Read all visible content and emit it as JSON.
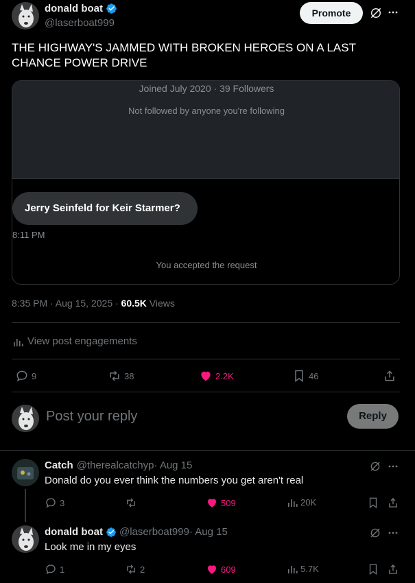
{
  "post": {
    "author_name": "donald boat",
    "author_handle": "@laserboat999",
    "promote_label": "Promote",
    "text": "THE HIGHWAY'S JAMMED WITH BROKEN HEROES ON A LAST CHANCE POWER DRIVE",
    "timestamp": "8:35 PM · Aug 15, 2025 · ",
    "views_count": "60.5K",
    "views_label": "Views",
    "engagements_label": "View post engagements"
  },
  "embedded_card": {
    "joined": "Joined July 2020 · 39 Followers",
    "not_followed": "Not followed by anyone you're following",
    "message": "Jerry Seinfeld for Keir Starmer?",
    "message_time": "8:11 PM",
    "accepted": "You accepted the request"
  },
  "actions": {
    "replies": "9",
    "reposts": "38",
    "likes": "2.2K",
    "bookmarks": "46"
  },
  "composer": {
    "placeholder": "Post your reply",
    "reply_label": "Reply"
  },
  "replies": [
    {
      "author_name": "Catch",
      "author_handle": "@therealcatchyp",
      "date": " · Aug 15",
      "text": "Donald do you ever think the numbers you get aren't real",
      "replies": "3",
      "reposts": "",
      "likes": "509",
      "views": "20K"
    },
    {
      "author_name": "donald boat",
      "author_handle": "@laserboat999",
      "date": " · Aug 15",
      "text": "Look me in my eyes",
      "replies": "1",
      "reposts": "2",
      "likes": "609",
      "views": "5.7K"
    }
  ],
  "colors": {
    "verified": "#1d9bf0",
    "like": "#f91880",
    "muted": "#71767b",
    "border": "#2f3336"
  }
}
